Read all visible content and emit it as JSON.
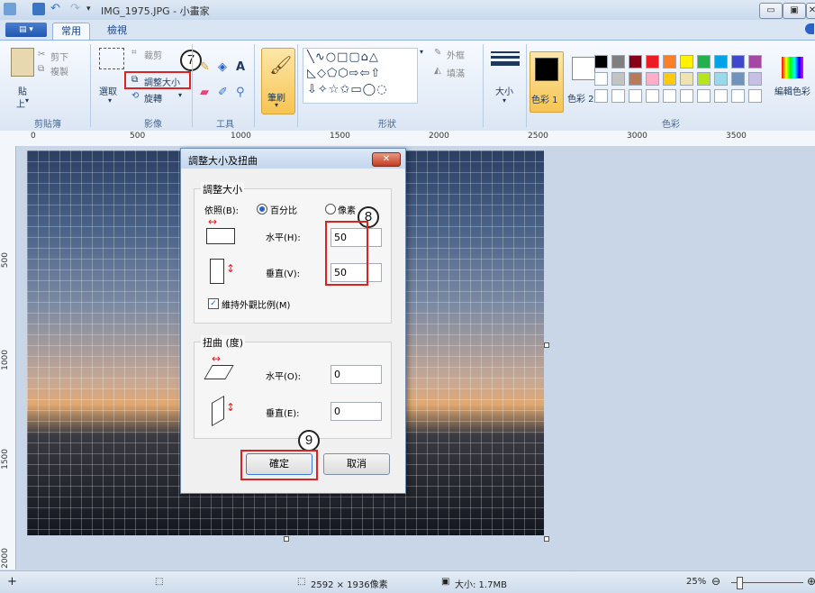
{
  "window": {
    "title": "IMG_1975.JPG - 小畫家"
  },
  "tabs": [
    {
      "label": "常用"
    },
    {
      "label": "檢視"
    }
  ],
  "ribbon": {
    "clipboard": {
      "paste": "貼",
      "paste2": "上",
      "cut": "剪下",
      "copy": "複製",
      "label": "剪貼簿"
    },
    "image": {
      "select": "選取",
      "crop": "裁剪",
      "resize": "調整大小",
      "rotate": "旋轉",
      "label": "影像"
    },
    "tools": {
      "label": "工具"
    },
    "brush": {
      "label": "筆刷"
    },
    "shapes": {
      "outline": "外框",
      "fill": "填滿",
      "label": "形狀"
    },
    "size": {
      "label": "大小"
    },
    "colors": {
      "color1": "色彩 1",
      "color2": "色彩 2",
      "edit": "編輯色彩",
      "label": "色彩"
    },
    "palette": [
      "#000000",
      "#7f7f7f",
      "#880015",
      "#ed1c24",
      "#ff7f27",
      "#fff200",
      "#22b14c",
      "#00a2e8",
      "#3f48cc",
      "#a349a4",
      "#ffffff",
      "#c3c3c3",
      "#b97a57",
      "#ffaec9",
      "#ffc90e",
      "#efe4b0",
      "#b5e61d",
      "#99d9ea",
      "#7092be",
      "#c8bfe7"
    ]
  },
  "callouts": {
    "c7": "7",
    "c8": "8",
    "c9": "9"
  },
  "ruler": {
    "top": [
      "0",
      "500",
      "1000",
      "1500",
      "2000",
      "2500",
      "3000",
      "3500"
    ],
    "left": [
      "500",
      "1000",
      "1500",
      "2000"
    ]
  },
  "dialog": {
    "title": "調整大小及扭曲",
    "resize_legend": "調整大小",
    "by_label": "依照(B):",
    "percent": "百分比",
    "pixels": "像素",
    "horizontal_label": "水平(H):",
    "horizontal_value": "50",
    "vertical_label": "垂直(V):",
    "vertical_value": "50",
    "maintain": "維持外觀比例(M)",
    "skew_legend": "扭曲 (度)",
    "skew_h_label": "水平(O):",
    "skew_h_value": "0",
    "skew_v_label": "垂直(E):",
    "skew_v_value": "0",
    "ok": "確定",
    "cancel": "取消"
  },
  "status": {
    "dimensions": "2592 × 1936像素",
    "size": "大小: 1.7MB",
    "zoom": "25%"
  }
}
